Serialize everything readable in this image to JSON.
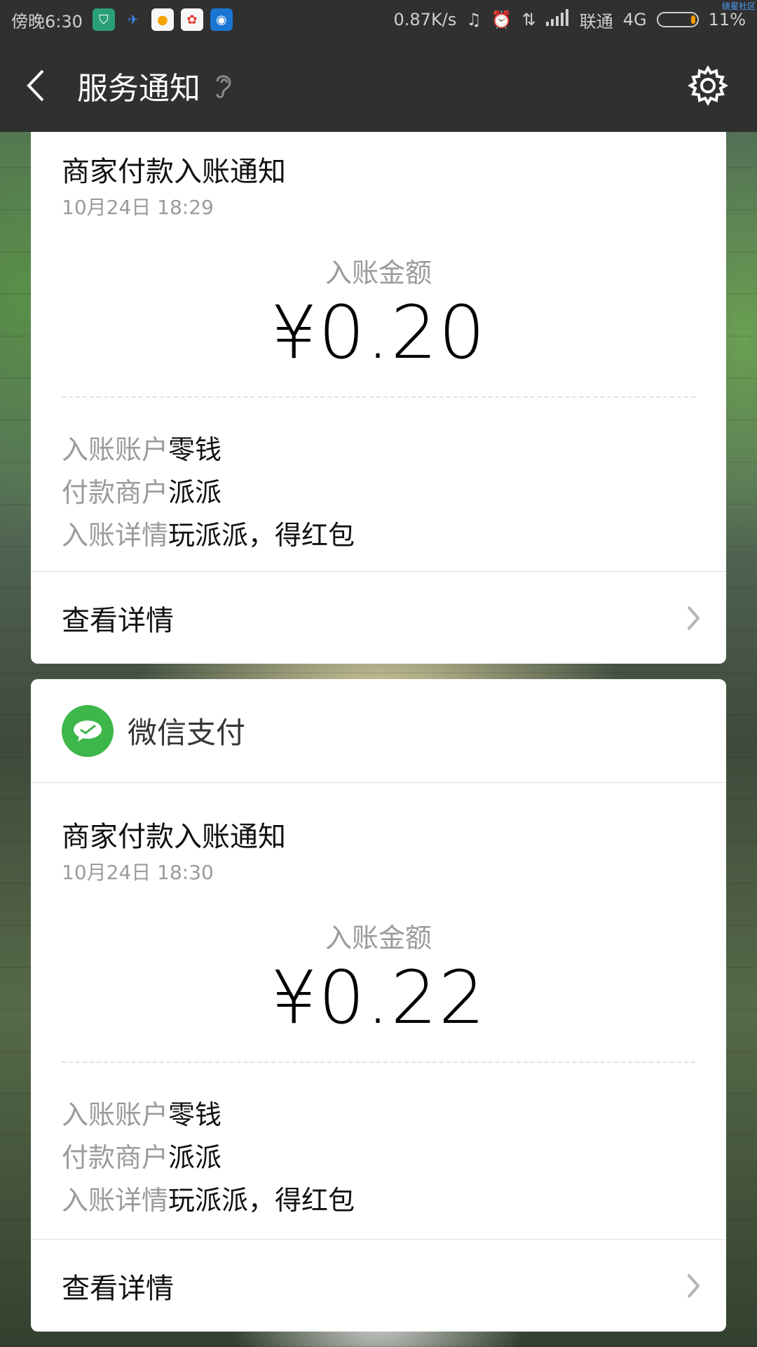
{
  "status_bar": {
    "time": "傍晚6:30",
    "net_speed": "0.87K/s",
    "carrier": "联通",
    "network_type": "4G",
    "battery": "11%",
    "watermark": "绕星社区",
    "apps": [
      {
        "name": "shield-app-icon",
        "color": "#2aa07a"
      },
      {
        "name": "bird-app-icon",
        "color": "#1e88e5"
      },
      {
        "name": "orange-app-icon",
        "color": "#f5b400"
      },
      {
        "name": "colorful-app-icon",
        "color": "#e53935"
      },
      {
        "name": "blue-app-icon",
        "color": "#1976d2"
      }
    ]
  },
  "header": {
    "title": "服务通知"
  },
  "cards": [
    {
      "title": "商家付款入账通知",
      "time": "10月24日  18:29",
      "amount_label": "入账金额",
      "amount": "¥0.20",
      "rows": [
        {
          "key": "入账账户",
          "value": "零钱"
        },
        {
          "key": "付款商户",
          "value": "派派"
        },
        {
          "key": "入账详情",
          "value": "玩派派，得红包"
        }
      ],
      "details_label": "查看详情"
    },
    {
      "header_label": "微信支付",
      "title": "商家付款入账通知",
      "time": "10月24日  18:30",
      "amount_label": "入账金额",
      "amount": "¥0.22",
      "rows": [
        {
          "key": "入账账户",
          "value": "零钱"
        },
        {
          "key": "付款商户",
          "value": "派派"
        },
        {
          "key": "入账详情",
          "value": "玩派派，得红包"
        }
      ],
      "details_label": "查看详情"
    }
  ],
  "colors": {
    "bar_bg": "#303030",
    "wechat_green": "#3db64a",
    "secondary_text": "#9b9b9b"
  }
}
